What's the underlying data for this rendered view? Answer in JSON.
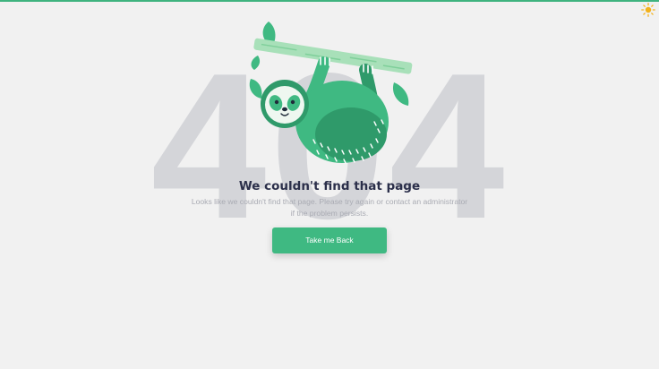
{
  "colors": {
    "accent": "#3fb982",
    "background": "#f1f1f1",
    "big_number": "#d4d5d9",
    "title": "#2b2f4a",
    "description": "#a9abb3"
  },
  "header": {
    "theme_icon": "sun-icon"
  },
  "hero": {
    "code": "404",
    "illustration": "sloth-hanging-on-branch"
  },
  "message": {
    "title": "We couldn't find that page",
    "description_line1": "Looks like we couldn't find that page. Please try again or contact an administrator",
    "description_line2": "if the problem persists."
  },
  "actions": {
    "back_label": "Take me Back"
  }
}
